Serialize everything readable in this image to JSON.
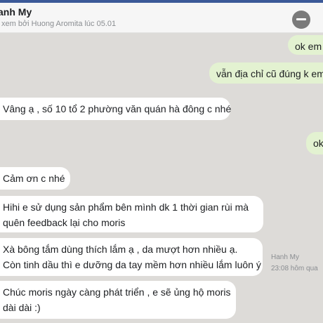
{
  "header": {
    "contact_name": "anh My",
    "seen_text": "xem bởi Huong Aromita lúc 05.01"
  },
  "messages": [
    {
      "direction": "outgoing",
      "text": "ok em"
    },
    {
      "direction": "outgoing",
      "text": "vẫn địa chỉ cũ đúng k em"
    },
    {
      "direction": "incoming",
      "text": "Vâng ạ , số 10 tổ 2 phường văn quán hà đông c nhé"
    },
    {
      "direction": "outgoing",
      "text": "ok"
    },
    {
      "direction": "incoming",
      "text": "Cảm ơn c nhé"
    },
    {
      "direction": "incoming",
      "lines": [
        "Hihi e sử dụng sản phẩm bên mình dk 1 thời gian rùi mà",
        "quên feedback lại cho moris"
      ]
    },
    {
      "direction": "incoming",
      "lines": [
        "Xà bông tắm dùng thích lắm ạ , da mượt hơn nhiều ạ.",
        "Còn tinh dầu thì e dưỡng da tay mềm hơn nhiều lắm luôn ý"
      ]
    },
    {
      "direction": "incoming",
      "lines": [
        "Chúc moris ngày càng phát triển , e sẽ ủng hộ moris",
        "dài dài :)"
      ]
    }
  ],
  "sender_meta": {
    "name": "Hanh My",
    "time": "23:08 hôm qua"
  },
  "colors": {
    "background": "#dddbd8",
    "incoming_bubble": "#ffffff",
    "outgoing_bubble": "#e3f2d1",
    "top_bar": "#3b5998"
  },
  "icons": {
    "close": "minus-circle-icon"
  }
}
